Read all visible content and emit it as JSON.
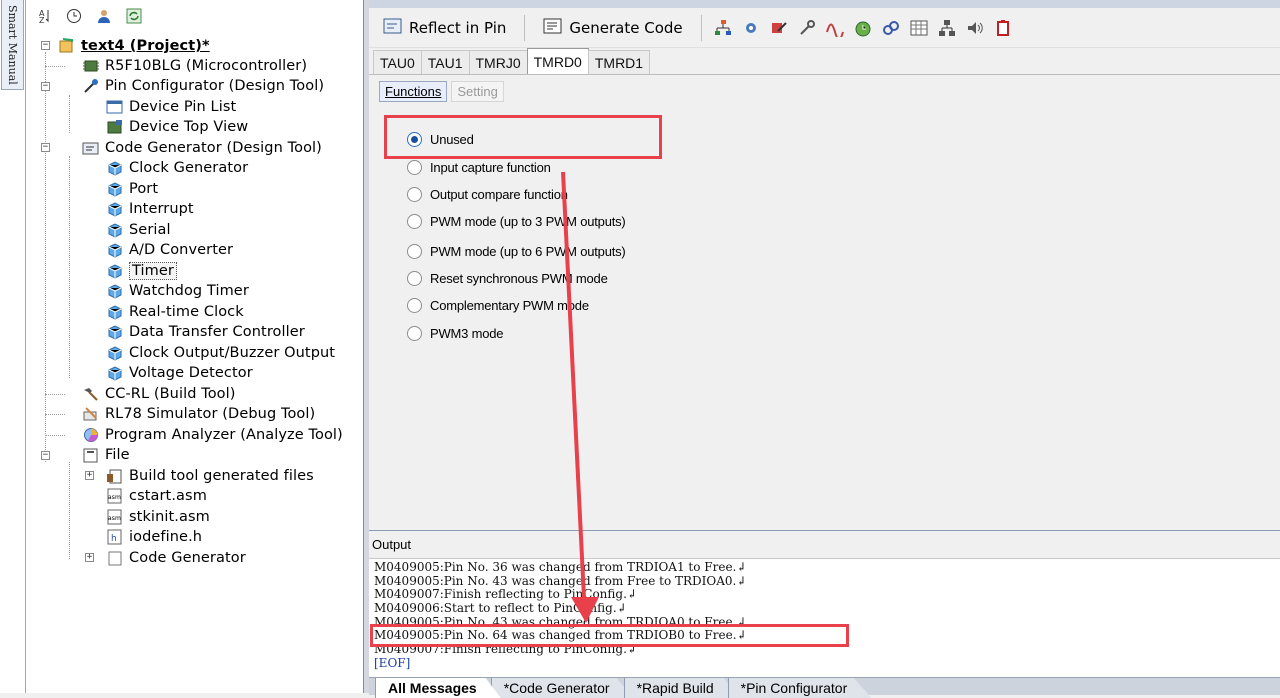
{
  "smart_manual_tab": "Smart Manual",
  "tree": {
    "project": "text4 (Project)*",
    "microcontroller": "R5F10BLG (Microcontroller)",
    "pin_configurator": "Pin Configurator (Design Tool)",
    "device_pin_list": "Device Pin List",
    "device_top_view": "Device Top View",
    "code_generator": "Code Generator (Design Tool)",
    "items": [
      "Clock Generator",
      "Port",
      "Interrupt",
      "Serial",
      "A/D Converter",
      "Timer",
      "Watchdog Timer",
      "Real-time Clock",
      "Data Transfer Controller",
      "Clock Output/Buzzer Output",
      "Voltage Detector"
    ],
    "build_tool": "CC-RL (Build Tool)",
    "debug_tool": "RL78 Simulator (Debug Tool)",
    "analyze_tool": "Program Analyzer (Analyze Tool)",
    "file": "File",
    "files": [
      "Build tool generated files",
      "cstart.asm",
      "stkinit.asm",
      "iodefine.h",
      "Code Generator"
    ]
  },
  "toolbar": {
    "reflect_in_pin": "Reflect in Pin",
    "generate_code": "Generate Code"
  },
  "peripheral_tabs": [
    "TAU0",
    "TAU1",
    "TMRJ0",
    "TMRD0",
    "TMRD1"
  ],
  "sub_tabs": {
    "functions": "Functions",
    "setting": "Setting"
  },
  "radio_options": [
    "Unused",
    "Input capture function",
    "Output compare function",
    "PWM mode (up to 3 PWM outputs)",
    "PWM mode (up to 6 PWM outputs)",
    "Reset synchronous PWM mode",
    "Complementary PWM mode",
    "PWM3 mode"
  ],
  "selected_option": "Unused",
  "output": {
    "title": "Output",
    "lines": [
      "M0409005:Pin No. 36 was changed from TRDIOA1 to Free.↲",
      "M0409005:Pin No. 43 was changed from Free to TRDIOA0.↲",
      "M0409007:Finish reflecting to PinConfig.↲",
      "M0409006:Start to reflect to PinConfig.↲",
      "M0409005:Pin No. 43 was changed from TRDIOA0 to Free.↲",
      "M0409005:Pin No. 64 was changed from TRDIOB0 to Free.↲",
      "M0409007:Finish reflecting to PinConfig.↲"
    ],
    "eof": "[EOF]",
    "tabs": [
      "All Messages",
      "*Code Generator",
      "*Rapid Build",
      "*Pin Configurator"
    ]
  },
  "colors": {
    "annotation": "#e8414b",
    "selection_blue": "#1b4f9c"
  }
}
